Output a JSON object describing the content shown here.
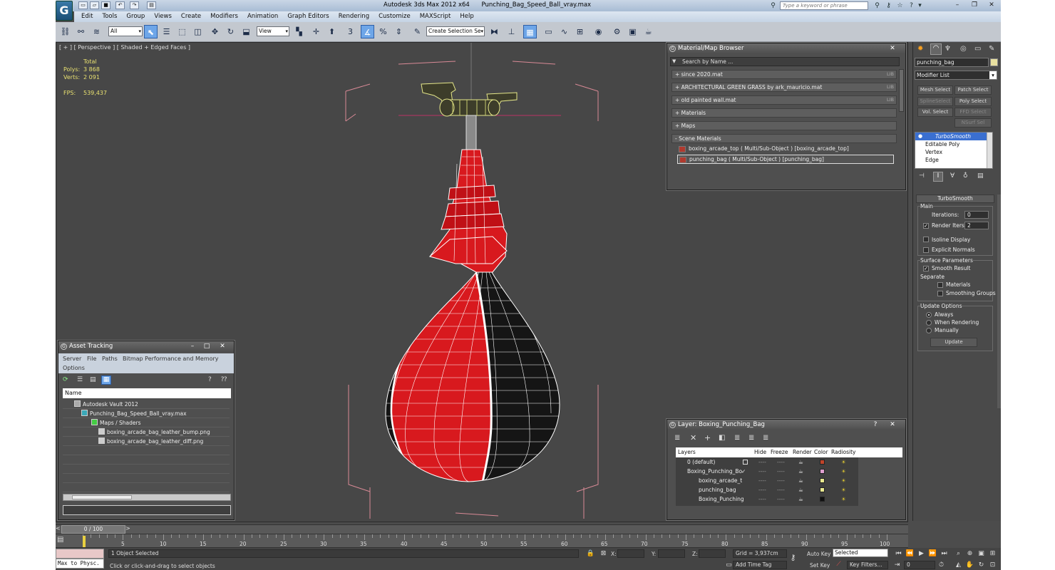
{
  "title": {
    "app": "Autodesk 3ds Max  2012 x64",
    "file": "Punching_Bag_Speed_Ball_vray.max",
    "search_placeholder": "Type a keyword or phrase"
  },
  "menu": [
    "Edit",
    "Tools",
    "Group",
    "Views",
    "Create",
    "Modifiers",
    "Animation",
    "Graph Editors",
    "Rendering",
    "Customize",
    "MAXScript",
    "Help"
  ],
  "toolbar": {
    "selection_filter": "All",
    "reference_coord": "View",
    "selection_set": "Create Selection Se",
    "snap_label": "3"
  },
  "viewport": {
    "label": "[ + ] [ Perspective ] [ Shaded + Edged Faces ]",
    "stats": {
      "header": "Total",
      "polys_label": "Polys:",
      "polys": "3 868",
      "verts_label": "Verts:",
      "verts": "2 091",
      "fps_label": "FPS:",
      "fps": "539,437"
    }
  },
  "material_browser": {
    "title": "Material/Map Browser",
    "search": "Search by Name ...",
    "libs": [
      {
        "label": "+ since 2020.mat",
        "tag": "LIB"
      },
      {
        "label": "+ ARCHITECTURAL GREEN GRASS by ark_mauricio.mat",
        "tag": "LIB"
      },
      {
        "label": "+ old painted wall.mat",
        "tag": "LIB"
      },
      {
        "label": "+ Materials",
        "tag": ""
      },
      {
        "label": "+ Maps",
        "tag": ""
      },
      {
        "label": "- Scene Materials",
        "tag": ""
      }
    ],
    "scene_materials": [
      "boxing_arcade_top  ( Multi/Sub-Object ) [boxing_arcade_top]",
      "punching_bag  ( Multi/Sub-Object ) [punching_bag]"
    ]
  },
  "asset_tracking": {
    "title": "Asset Tracking",
    "menu": [
      "Server",
      "File",
      "Paths",
      "Bitmap Performance and Memory"
    ],
    "menu2": "Options",
    "column": "Name",
    "tree": [
      {
        "label": "Autodesk Vault 2012",
        "indent": 0
      },
      {
        "label": "Punching_Bag_Speed_Ball_vray.max",
        "indent": 1
      },
      {
        "label": "Maps / Shaders",
        "indent": 2
      },
      {
        "label": "boxing_arcade_bag_leather_bump.png",
        "indent": 3
      },
      {
        "label": "boxing_arcade_bag_leather_diff.png",
        "indent": 3
      }
    ]
  },
  "layer": {
    "title": "Layer: Boxing_Punching_Bag",
    "columns": [
      "Layers",
      "Hide",
      "Freeze",
      "Render",
      "Color",
      "Radiosity"
    ],
    "rows": [
      {
        "name": "0 (default)",
        "indent": 0,
        "color": "#c0442a"
      },
      {
        "name": "Boxing_Punching_Bo",
        "indent": 0,
        "color": "#e0a0d0"
      },
      {
        "name": "boxing_arcade_t",
        "indent": 1,
        "color": "#e8e890"
      },
      {
        "name": "punching_bag",
        "indent": 1,
        "color": "#e8e890"
      },
      {
        "name": "Boxing_Punching",
        "indent": 1,
        "color": "#111111"
      }
    ]
  },
  "command_panel": {
    "object_name": "punching_bag",
    "modifier_list": "Modifier List",
    "buttons": [
      "Mesh Select",
      "Patch Select",
      "SplineSelect",
      "Poly Select",
      "Vol. Select",
      "FFD Select",
      "NSurf Sel"
    ],
    "stack": [
      "TurboSmooth",
      "Editable Poly",
      "Vertex",
      "Edge"
    ],
    "rollout_title": "TurboSmooth",
    "main_label": "Main",
    "iterations_label": "Iterations:",
    "iterations": "0",
    "render_iters_label": "Render Iters:",
    "render_iters": "2",
    "isoline": "Isoline Display",
    "explicit": "Explicit Normals",
    "surface_label": "Surface Parameters",
    "smooth_result": "Smooth Result",
    "separate": "Separate",
    "materials": "Materials",
    "smoothing_groups": "Smoothing Groups",
    "update_options": "Update Options",
    "always": "Always",
    "when_rendering": "When Rendering",
    "manually": "Manually",
    "update": "Update"
  },
  "timeline": {
    "frame": "0 / 100",
    "ticks": [
      "5",
      "10",
      "15",
      "20",
      "25",
      "30",
      "35",
      "40",
      "45",
      "50",
      "55",
      "60",
      "65",
      "70",
      "75",
      "80",
      "85",
      "90",
      "95",
      "100"
    ]
  },
  "status": {
    "maxscript": "Max to Physc.",
    "selected": "1 Object Selected",
    "hint": "Click or click-and-drag to select objects",
    "x_label": "X:",
    "y_label": "Y:",
    "z_label": "Z:",
    "grid": "Grid = 3,937cm",
    "add_time_tag": "Add Time Tag",
    "auto_key": "Auto Key",
    "auto_key_value": "Selected",
    "set_key": "Set Key",
    "key_filters": "Key Filters...",
    "frame_field": "0"
  }
}
